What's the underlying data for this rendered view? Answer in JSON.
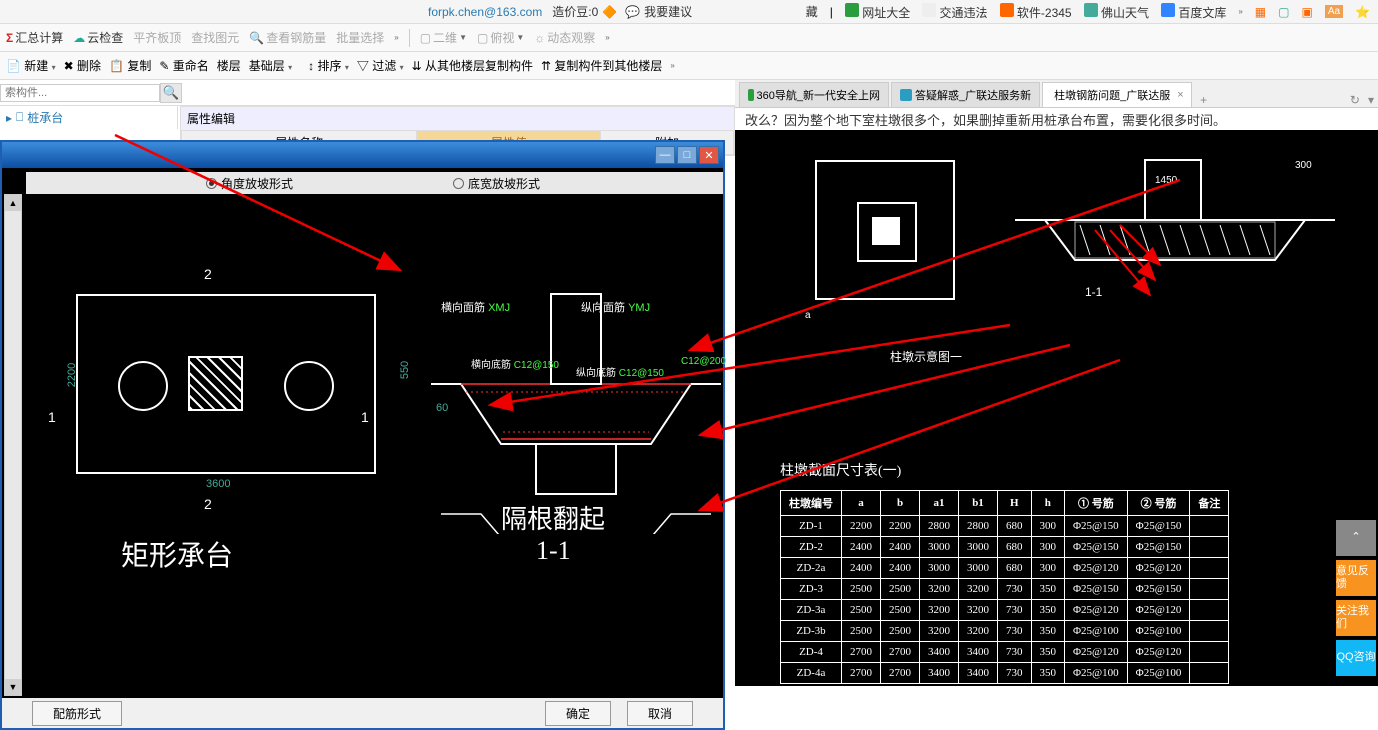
{
  "topbar": {
    "email": "forpk.chen@163.com",
    "score_label": "造价豆:0",
    "suggest": "我要建议",
    "fav": "藏",
    "links": [
      "网址大全",
      "交通违法",
      "软件-2345",
      "佛山天气",
      "百度文库"
    ]
  },
  "toolbar1": {
    "sum": "汇总计算",
    "cloud": "云检查",
    "flatten": "平齐板顶",
    "viewfig": "查找图元",
    "viewrebar": "查看钢筋量",
    "batch": "批量选择",
    "view2d": "二维",
    "bird": "俯视",
    "dyn": "动态观察"
  },
  "toolbar2": {
    "new": "新建",
    "del": "删除",
    "copy": "复制",
    "rename": "重命名",
    "floor": "楼层",
    "baselayer": "基础层",
    "sort": "排序",
    "filter": "过滤",
    "copyfrom": "从其他楼层复制构件",
    "copyto": "复制构件到其他楼层"
  },
  "search": {
    "placeholder": "索构件..."
  },
  "tree": {
    "root": "桩承台"
  },
  "prop": {
    "title": "属性编辑",
    "col_name": "属性名称",
    "col_val": "属性值",
    "col_extra": "附加"
  },
  "dialog": {
    "radio1": "角度放坡形式",
    "radio2": "底宽放坡形式",
    "plan_label": "矩形承台",
    "section_label": "隔根翻起",
    "section_sub": "1-1",
    "dim_w": "3600",
    "dim_h": "2200",
    "dim_sec_h": "550",
    "rebar1": "横向面筋",
    "rebar1_val": "XMJ",
    "rebar2": "纵向面筋",
    "rebar2_val": "YMJ",
    "rebar3": "横向底筋",
    "rebar3_val": "C12@150",
    "rebar4": "纵向底筋",
    "rebar4_val": "C12@150",
    "rebar5_val": "C12@200",
    "dim60": "60",
    "btn_shape": "配筋形式",
    "btn_ok": "确定",
    "btn_cancel": "取消"
  },
  "browser": {
    "tabs": [
      "360导航_新一代安全上网",
      "答疑解惑_广联达服务新",
      "柱墩钢筋问题_广联达服"
    ],
    "content_top": "改么？因为整个地下室柱墩很多个，如果删掉重新用桩承台布置，需要化很多时间。",
    "table_title": "柱墩截面尺寸表(一)",
    "plan_label": "柱墩示意图一",
    "sec_label": "1-1",
    "table_headers": [
      "柱墩编号",
      "a",
      "b",
      "a1",
      "b1",
      "H",
      "h",
      "① 号筋",
      "② 号筋",
      "备注"
    ],
    "table_rows": [
      [
        "ZD-1",
        "2200",
        "2200",
        "2800",
        "2800",
        "680",
        "300",
        "Φ25@150",
        "Φ25@150",
        ""
      ],
      [
        "ZD-2",
        "2400",
        "2400",
        "3000",
        "3000",
        "680",
        "300",
        "Φ25@150",
        "Φ25@150",
        ""
      ],
      [
        "ZD-2a",
        "2400",
        "2400",
        "3000",
        "3000",
        "680",
        "300",
        "Φ25@120",
        "Φ25@120",
        ""
      ],
      [
        "ZD-3",
        "2500",
        "2500",
        "3200",
        "3200",
        "730",
        "350",
        "Φ25@150",
        "Φ25@150",
        ""
      ],
      [
        "ZD-3a",
        "2500",
        "2500",
        "3200",
        "3200",
        "730",
        "350",
        "Φ25@120",
        "Φ25@120",
        ""
      ],
      [
        "ZD-3b",
        "2500",
        "2500",
        "3200",
        "3200",
        "730",
        "350",
        "Φ25@100",
        "Φ25@100",
        ""
      ],
      [
        "ZD-4",
        "2700",
        "2700",
        "3400",
        "3400",
        "730",
        "350",
        "Φ25@120",
        "Φ25@120",
        ""
      ],
      [
        "ZD-4a",
        "2700",
        "2700",
        "3400",
        "3400",
        "730",
        "350",
        "Φ25@100",
        "Φ25@100",
        ""
      ]
    ]
  },
  "sidebuttons": {
    "top": "⌃",
    "feedback": "意见反馈",
    "follow": "关注我们",
    "qq": "QQ咨询"
  },
  "chart_data": {
    "type": "table",
    "title": "柱墩截面尺寸表(一)",
    "columns": [
      "柱墩编号",
      "a",
      "b",
      "a1",
      "b1",
      "H",
      "h",
      "① 号筋",
      "② 号筋"
    ],
    "rows": [
      [
        "ZD-1",
        2200,
        2200,
        2800,
        2800,
        680,
        300,
        "Φ25@150",
        "Φ25@150"
      ],
      [
        "ZD-2",
        2400,
        2400,
        3000,
        3000,
        680,
        300,
        "Φ25@150",
        "Φ25@150"
      ],
      [
        "ZD-2a",
        2400,
        2400,
        3000,
        3000,
        680,
        300,
        "Φ25@120",
        "Φ25@120"
      ],
      [
        "ZD-3",
        2500,
        2500,
        3200,
        3200,
        730,
        350,
        "Φ25@150",
        "Φ25@150"
      ],
      [
        "ZD-3a",
        2500,
        2500,
        3200,
        3200,
        730,
        350,
        "Φ25@120",
        "Φ25@120"
      ],
      [
        "ZD-3b",
        2500,
        2500,
        3200,
        3200,
        730,
        350,
        "Φ25@100",
        "Φ25@100"
      ],
      [
        "ZD-4",
        2700,
        2700,
        3400,
        3400,
        730,
        350,
        "Φ25@120",
        "Φ25@120"
      ],
      [
        "ZD-4a",
        2700,
        2700,
        3400,
        3400,
        730,
        350,
        "Φ25@100",
        "Φ25@100"
      ]
    ]
  }
}
